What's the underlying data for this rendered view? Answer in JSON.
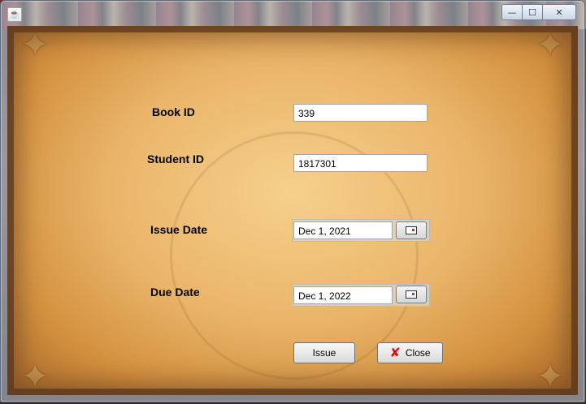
{
  "window": {
    "app_icon": "java-cup-icon",
    "controls": {
      "minimize": "—",
      "maximize": "☐",
      "close": "✕"
    }
  },
  "form": {
    "book_id": {
      "label": "Book ID",
      "value": "339"
    },
    "student_id": {
      "label": "Student ID",
      "value": "1817301"
    },
    "issue_date": {
      "label": "Issue Date",
      "value": "Dec 1, 2021"
    },
    "due_date": {
      "label": "Due Date",
      "value": "Dec 1, 2022"
    }
  },
  "buttons": {
    "issue": "Issue",
    "close": "Close",
    "close_icon": "red-x-icon"
  },
  "colors": {
    "parchment": "#eab56a",
    "close_x": "#dd1111"
  }
}
